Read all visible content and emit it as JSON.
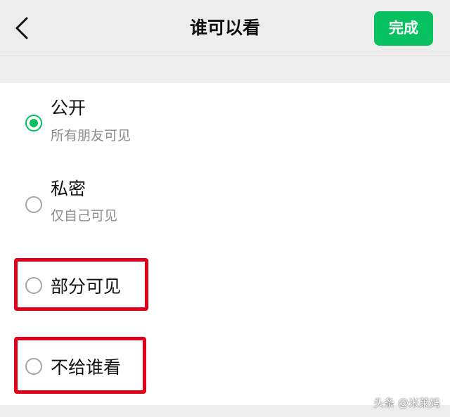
{
  "nav": {
    "title": "谁可以看",
    "done_label": "完成"
  },
  "options": [
    {
      "title": "公开",
      "subtitle": "所有朋友可见",
      "selected": true
    },
    {
      "title": "私密",
      "subtitle": "仅自己可见",
      "selected": false
    },
    {
      "title": "部分可见",
      "selected": false,
      "highlighted": true
    },
    {
      "title": "不给谁看",
      "selected": false,
      "highlighted": true
    }
  ],
  "watermark": "头条 @米莱妈",
  "colors": {
    "accent": "#07c160",
    "highlight": "#e0001a",
    "background": "#ededed"
  },
  "icons": {
    "back": "chevron-left-icon"
  }
}
